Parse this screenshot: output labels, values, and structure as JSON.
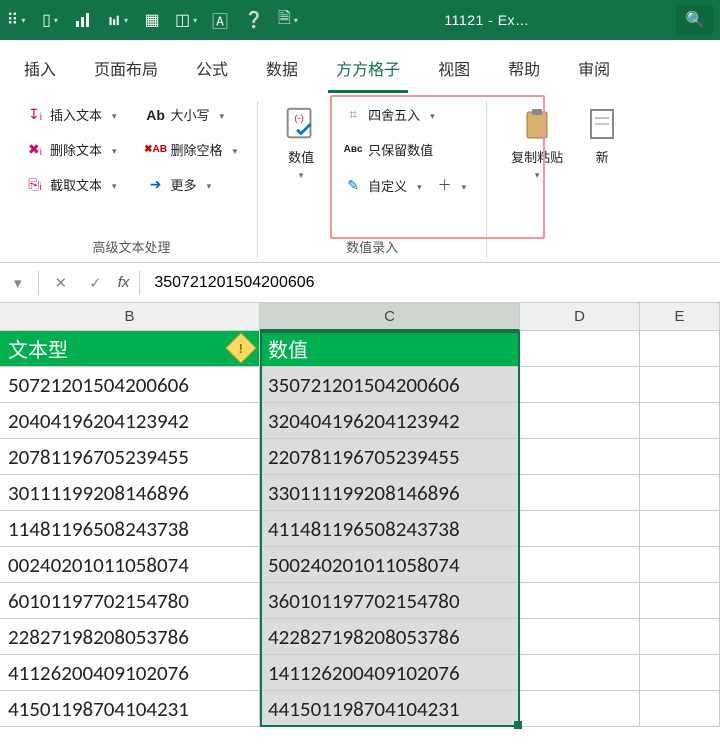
{
  "titlebar": {
    "doc_title": "11121 - Ex…",
    "qat_icons": [
      "grid-dots-icon",
      "vert-bar-icon",
      "bar-chart-icon",
      "column-chart-icon",
      "table-icon",
      "shapes-icon",
      "text-box-icon",
      "help-icon",
      "page-icon"
    ]
  },
  "tabs": {
    "items": [
      "插入",
      "页面布局",
      "公式",
      "数据",
      "方方格子",
      "视图",
      "帮助",
      "审阅"
    ],
    "active_index": 4
  },
  "ribbon": {
    "group1": {
      "label": "高级文本处理",
      "left": {
        "insert_text": "插入文本",
        "delete_text": "删除文本",
        "extract_text": "截取文本"
      },
      "right": {
        "case": "大小写",
        "trim_spaces": "删除空格",
        "more": "更多"
      }
    },
    "group2": {
      "label": "数值录入",
      "big": {
        "label": "数值"
      },
      "right": {
        "round": "四舍五入",
        "keep_value": "只保留数值",
        "custom": "自定义"
      }
    },
    "group3": {
      "copy_paste": "复制粘贴",
      "new": "新"
    }
  },
  "formula_bar": {
    "value": "350721201504200606"
  },
  "columns": [
    "B",
    "C",
    "D",
    "E"
  ],
  "selected_column_index": 1,
  "headers": {
    "B": "文本型",
    "C": "数值"
  },
  "rows": [
    {
      "B": "50721201504200606",
      "C": "350721201504200606"
    },
    {
      "B": "20404196204123942",
      "C": "320404196204123942"
    },
    {
      "B": "20781196705239455",
      "C": "220781196705239455"
    },
    {
      "B": "30111199208146896",
      "C": "330111199208146896"
    },
    {
      "B": "11481196508243738",
      "C": "411481196508243738"
    },
    {
      "B": "00240201011058074",
      "C": "500240201011058074"
    },
    {
      "B": "60101197702154780",
      "C": "360101197702154780"
    },
    {
      "B": "22827198208053786",
      "C": "422827198208053786"
    },
    {
      "B": "41126200409102076",
      "C": "141126200409102076"
    },
    {
      "B": "41501198704104231",
      "C": "441501198704104231"
    }
  ]
}
